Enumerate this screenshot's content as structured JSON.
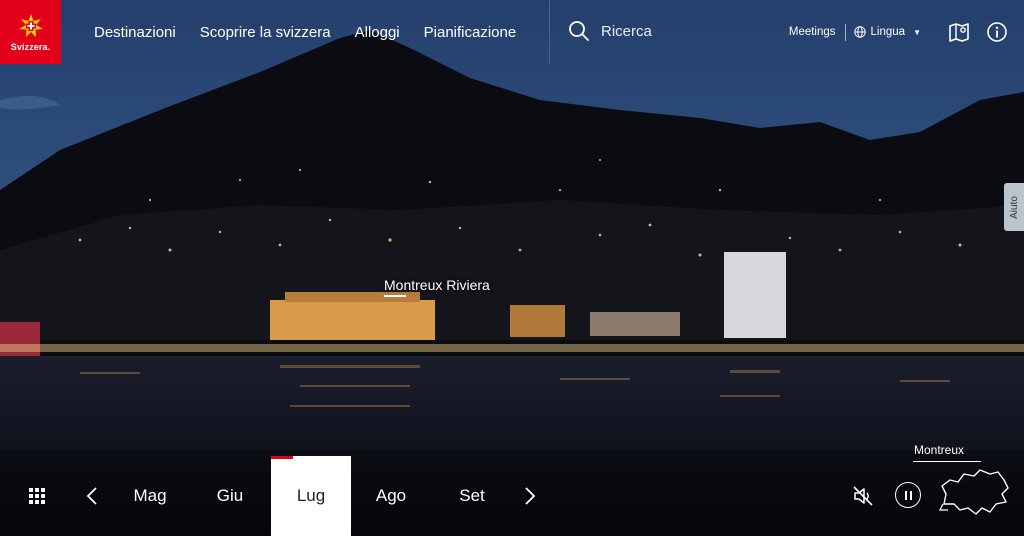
{
  "brand": {
    "name": "Svizzera."
  },
  "nav": {
    "items": [
      "Destinazioni",
      "Scoprire la svizzera",
      "Alloggi",
      "Pianificazione"
    ]
  },
  "search": {
    "label": "Ricerca",
    "icon": "search-icon"
  },
  "utility": {
    "meetings": "Meetings",
    "language": "Lingua",
    "icons": [
      "globe-icon",
      "map-icon",
      "info-icon"
    ]
  },
  "help": {
    "label": "Aiuto"
  },
  "hero": {
    "place_label": "Montreux Riviera"
  },
  "months": {
    "items": [
      "Mag",
      "Giu",
      "Lug",
      "Ago",
      "Set"
    ],
    "selected": "Lug"
  },
  "player": {
    "location": "Montreux",
    "icons": [
      "mute-icon",
      "pause-icon",
      "switzerland-map-icon"
    ]
  },
  "colors": {
    "brand_red": "#e2001a",
    "sky": "#1d3a66",
    "lake": "#0c1424"
  }
}
